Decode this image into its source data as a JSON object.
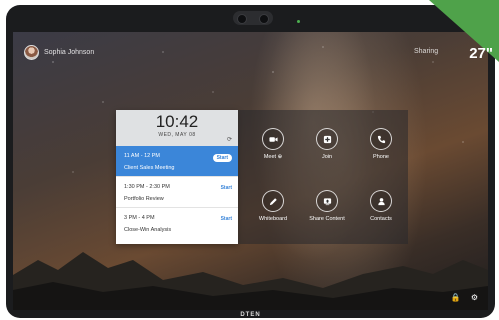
{
  "device": {
    "brand": "DTEN"
  },
  "badge": {
    "size_label": "27\"",
    "color": "#4fa24a"
  },
  "header": {
    "user_name": "Sophia Johnson",
    "sharing_label": "Sharing"
  },
  "calendar": {
    "time": "10:42",
    "date": "WED, MAY 08",
    "refresh_icon": "refresh-icon",
    "meetings": [
      {
        "time": "11 AM - 12 PM",
        "title": "Client Sales Meeting",
        "action": "Start",
        "active": true
      },
      {
        "time": "1:30 PM - 2:30 PM",
        "title": "Portfolio Review",
        "action": "Start",
        "active": false
      },
      {
        "time": "3 PM - 4 PM",
        "title": "Close-Win Analysis",
        "action": "Start",
        "active": false
      }
    ]
  },
  "actions": [
    {
      "label": "Meet ⊕",
      "icon": "video-camera-icon"
    },
    {
      "label": "Join",
      "icon": "plus-icon"
    },
    {
      "label": "Phone",
      "icon": "phone-icon"
    },
    {
      "label": "Whiteboard",
      "icon": "pencil-icon"
    },
    {
      "label": "Share Content",
      "icon": "share-screen-icon"
    },
    {
      "label": "Contacts",
      "icon": "person-icon"
    }
  ],
  "footer": {
    "lock_icon": "lock-icon",
    "settings_icon": "gear-icon"
  }
}
